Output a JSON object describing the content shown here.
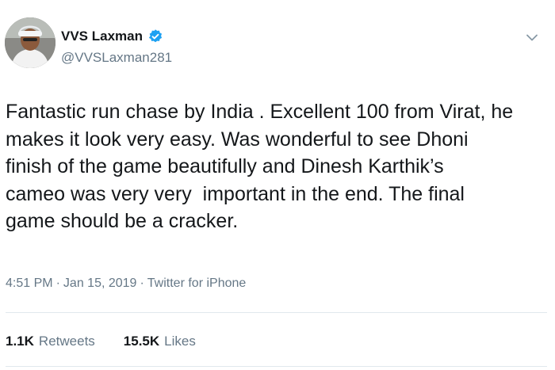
{
  "user": {
    "display_name": "VVS Laxman",
    "handle": "@VVSLaxman281"
  },
  "tweet": {
    "lines": [
      "Fantastic run chase by India . Excellent 100 from Virat, he",
      "makes it look very easy. Was wonderful to see Dhoni",
      "finish of the game beautifully and Dinesh Karthik’s",
      "cameo was very very  important in the end. The final",
      "game should be a cracker."
    ],
    "time": "4:51 PM",
    "date": "Jan 15, 2019",
    "source": "Twitter for iPhone",
    "separator": "·"
  },
  "stats": {
    "retweets_count": "1.1K",
    "retweets_label": "Retweets",
    "likes_count": "15.5K",
    "likes_label": "Likes"
  },
  "icons": {
    "verified": "verified-badge-icon",
    "menu": "chevron-down-icon"
  },
  "colors": {
    "text": "#14171a",
    "secondary": "#657786",
    "verified": "#1da1f2",
    "divider": "#e1e8ed"
  }
}
